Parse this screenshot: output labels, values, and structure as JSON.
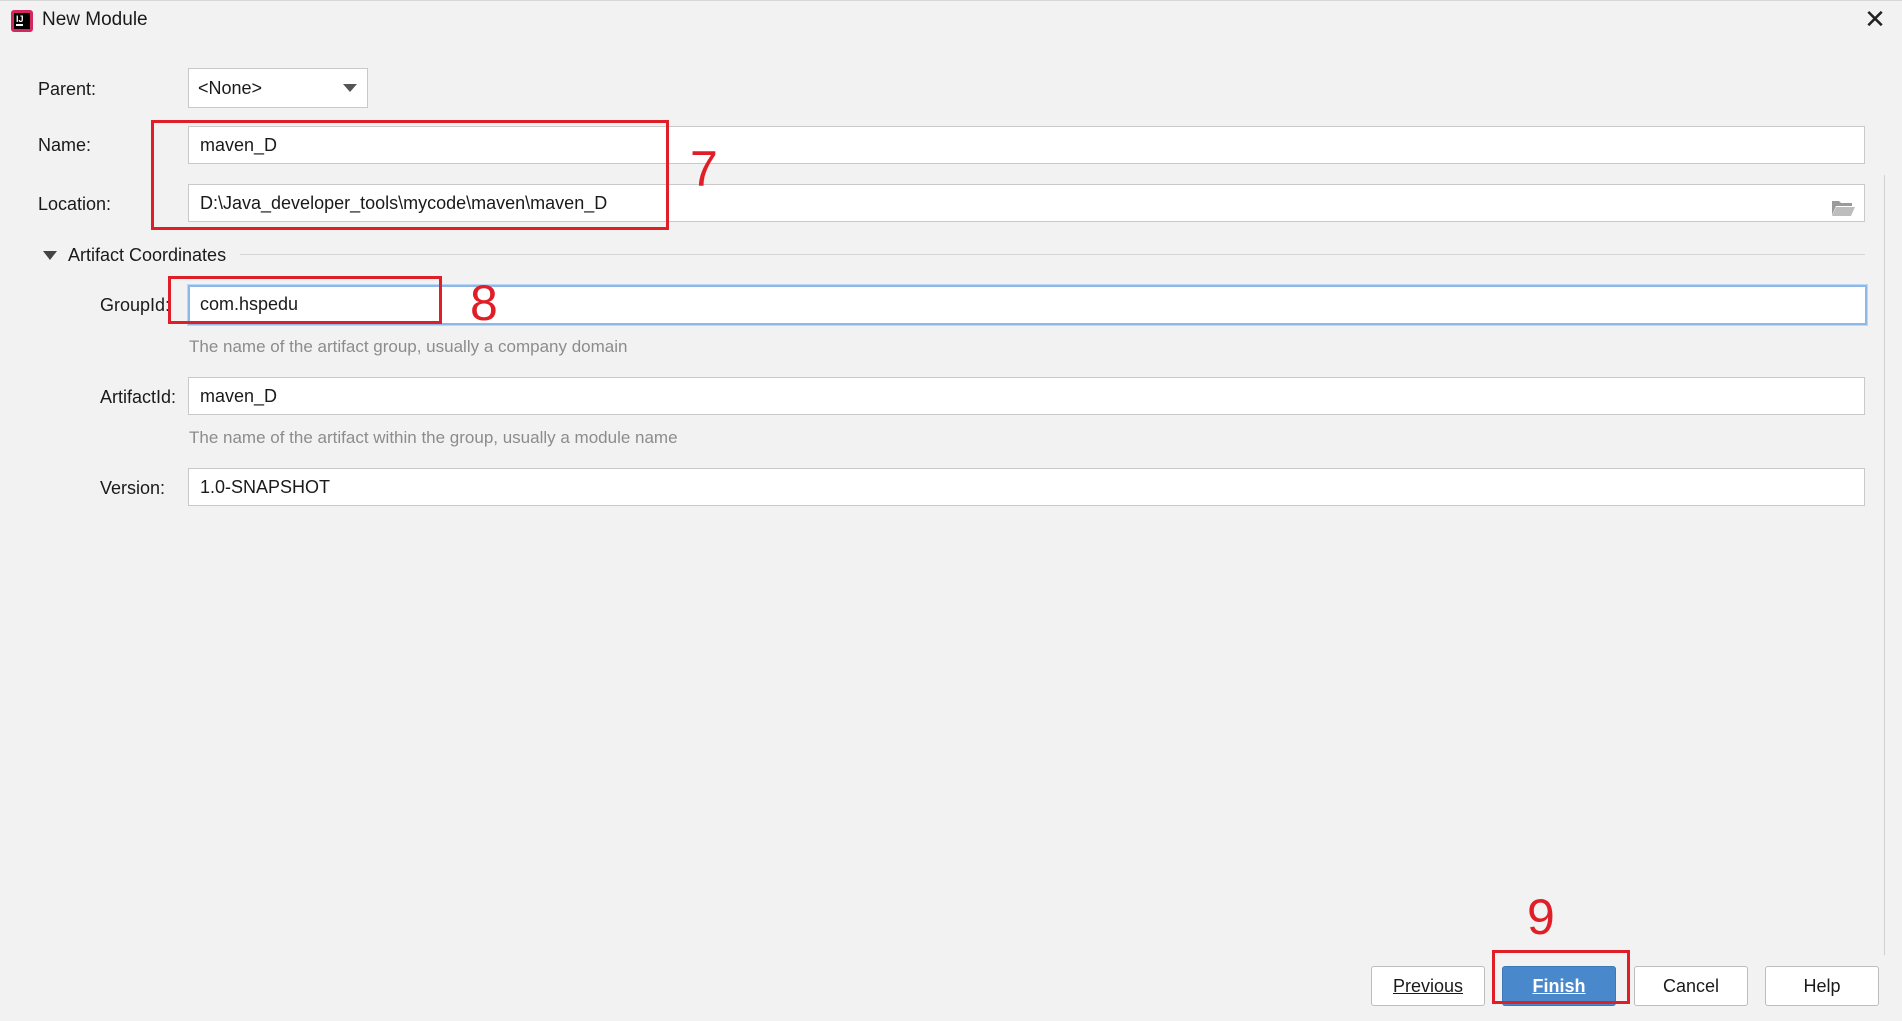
{
  "window": {
    "title": "New Module",
    "icon": "intellij-app-icon",
    "close_icon": "close-icon"
  },
  "form": {
    "parent": {
      "label": "Parent:",
      "value": "<None>"
    },
    "name": {
      "label": "Name:",
      "value": "maven_D"
    },
    "location": {
      "label": "Location:",
      "value": "D:\\Java_developer_tools\\mycode\\maven\\maven_D",
      "browse_icon": "folder-open-icon"
    },
    "artifact_section": {
      "title": "Artifact Coordinates",
      "expanded": true,
      "group_id": {
        "label": "GroupId:",
        "value": "com.hspedu",
        "hint": "The name of the artifact group, usually a company domain"
      },
      "artifact_id": {
        "label": "ArtifactId:",
        "value": "maven_D",
        "hint": "The name of the artifact within the group, usually a module name"
      },
      "version": {
        "label": "Version:",
        "value": "1.0-SNAPSHOT"
      }
    }
  },
  "buttons": {
    "previous": "Previous",
    "finish": "Finish",
    "cancel": "Cancel",
    "help": "Help"
  },
  "annotations": {
    "step_7": "7",
    "step_8": "8",
    "step_9": "9"
  },
  "colors": {
    "annotation_red": "#e01e27",
    "primary_button": "#4a88cc",
    "focus_border": "#8fb8e8"
  }
}
